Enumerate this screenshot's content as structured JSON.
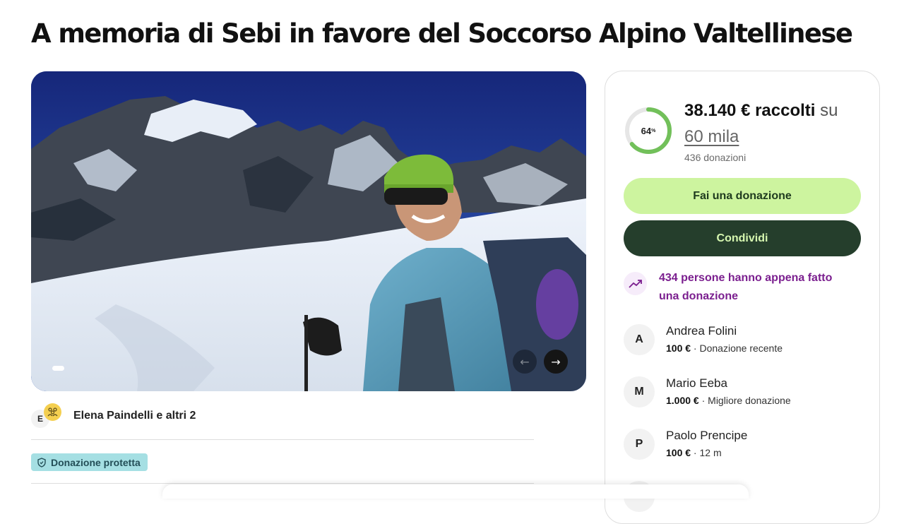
{
  "page": {
    "title": "A memoria di Sebi in favore del Soccorso Alpino Valtellinese"
  },
  "hero": {
    "description": "Photo of a smiling mountaineer in a green beanie and sunglasses with a blue jacket, ski poles and a backpack, in front of snowy rocky peaks under a deep blue sky",
    "prev_icon": "←",
    "next_icon": "→",
    "slide_index": 1
  },
  "organizer": {
    "initial": "E",
    "name": "Elena Paindelli e altri 2"
  },
  "badge": {
    "label": "Donazione protetta"
  },
  "donation": {
    "progress_percent": 64,
    "progress_label": "64",
    "percent_sign": "%",
    "raised": "38.140 € raccolti",
    "su": " su",
    "goal": "60 mila",
    "count": "436 donazioni",
    "donate_label": "Fai una donazione",
    "share_label": "Condividi",
    "trend_text": "434 persone hanno appena fatto una donazione"
  },
  "donors": [
    {
      "initial": "A",
      "name": "Andrea Folini",
      "amount": "100 €",
      "note": " · Donazione recente"
    },
    {
      "initial": "M",
      "name": "Mario Eeba",
      "amount": "1.000 €",
      "note": " · Migliore donazione"
    },
    {
      "initial": "P",
      "name": "Paolo Prencipe",
      "amount": "100 €",
      "note": " · 12 m"
    }
  ],
  "colors": {
    "progress": "#72c05a",
    "donate_bg": "#cdf49f",
    "share_bg": "#253e2c",
    "trend_text": "#7b1f8f",
    "badge_bg": "#a5dfe3"
  }
}
